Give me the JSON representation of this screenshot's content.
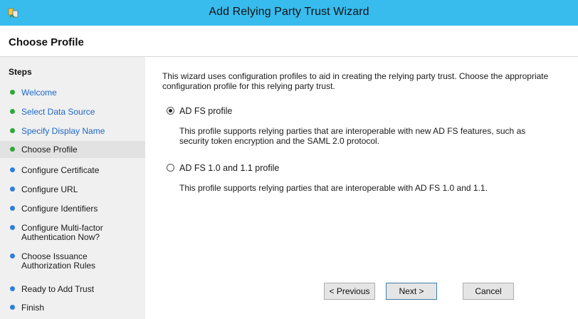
{
  "window": {
    "title": "Add Relying Party Trust Wizard",
    "accent_color": "#38bcee",
    "icon": "wizard-app-icon"
  },
  "header": {
    "page_title": "Choose Profile"
  },
  "steps": {
    "heading": "Steps",
    "items": [
      {
        "label": "Welcome",
        "status": "done",
        "status_color": "#2fa838"
      },
      {
        "label": "Select Data Source",
        "status": "done",
        "status_color": "#2fa838"
      },
      {
        "label": "Specify Display Name",
        "status": "done",
        "status_color": "#2fa838"
      },
      {
        "label": "Choose Profile",
        "status": "current",
        "status_color": "#2fa838"
      },
      {
        "label": "Configure Certificate",
        "status": "pending",
        "status_color": "#2d7fd8"
      },
      {
        "label": "Configure URL",
        "status": "pending",
        "status_color": "#2d7fd8"
      },
      {
        "label": "Configure Identifiers",
        "status": "pending",
        "status_color": "#2d7fd8"
      },
      {
        "label_line1": "Configure Multi-factor",
        "label_line2": "Authentication Now?",
        "status": "pending",
        "status_color": "#2d7fd8"
      },
      {
        "label_line1": "Choose Issuance",
        "label_line2": "Authorization Rules",
        "status": "pending",
        "status_color": "#2d7fd8"
      },
      {
        "label": "Ready to Add Trust",
        "status": "pending",
        "status_color": "#2d7fd8"
      },
      {
        "label": "Finish",
        "status": "pending",
        "status_color": "#2d7fd8"
      }
    ]
  },
  "main": {
    "intro_line1": "This wizard uses configuration profiles to aid in creating the relying party trust.  Choose the appropriate",
    "intro_line2": "configuration profile for this relying party trust.",
    "options": [
      {
        "label": "AD FS profile",
        "selected": true,
        "desc_line1": "This profile supports relying parties that are interoperable with new AD FS features, such as",
        "desc_line2": "security token encryption and the SAML 2.0 protocol."
      },
      {
        "label": "AD FS 1.0 and 1.1 profile",
        "selected": false,
        "desc_line1": "This profile supports relying parties that are interoperable with AD FS 1.0 and 1.1."
      }
    ]
  },
  "buttons": {
    "previous": "< Previous",
    "next": "Next >",
    "cancel": "Cancel"
  }
}
